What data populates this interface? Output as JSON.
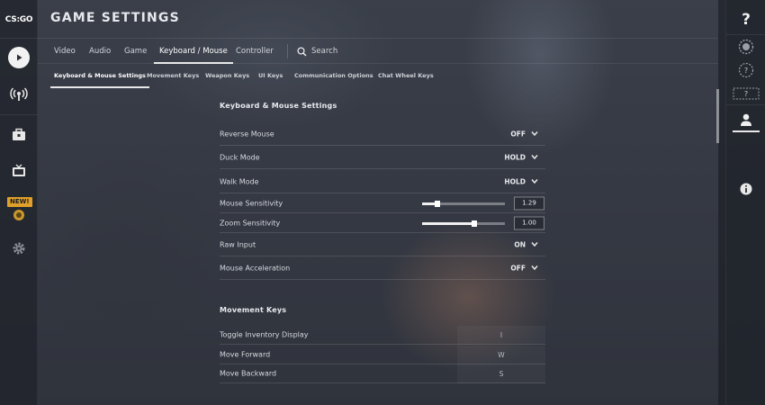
{
  "app": {
    "logo_text": "CS:GO",
    "title": "GAME SETTINGS"
  },
  "left_nav": {
    "new_badge": "NEW!",
    "items": [
      {
        "icon": "play-icon"
      },
      {
        "icon": "broadcast-icon"
      },
      {
        "icon": "inventory-icon"
      },
      {
        "icon": "tv-icon"
      },
      {
        "icon": "operation-icon"
      },
      {
        "icon": "settings-gear-icon"
      }
    ]
  },
  "tabs": [
    {
      "label": "Video"
    },
    {
      "label": "Audio"
    },
    {
      "label": "Game"
    },
    {
      "label": "Keyboard / Mouse",
      "active": true
    },
    {
      "label": "Controller"
    },
    {
      "label": "Search"
    }
  ],
  "subtabs": [
    {
      "label": "Keyboard & Mouse Settings",
      "active": true
    },
    {
      "label": "Movement Keys"
    },
    {
      "label": "Weapon Keys"
    },
    {
      "label": "UI Keys"
    },
    {
      "label": "Communication Options"
    },
    {
      "label": "Chat Wheel Keys"
    }
  ],
  "sections": {
    "km_title": "Keyboard & Mouse Settings",
    "reverse_mouse": {
      "label": "Reverse Mouse",
      "value": "OFF"
    },
    "duck_mode": {
      "label": "Duck Mode",
      "value": "HOLD"
    },
    "walk_mode": {
      "label": "Walk Mode",
      "value": "HOLD"
    },
    "mouse_sensitivity": {
      "label": "Mouse Sensitivity",
      "value": "1.29",
      "fill": 0.18
    },
    "zoom_sensitivity": {
      "label": "Zoom Sensitivity",
      "value": "1.00",
      "fill": 0.63
    },
    "raw_input": {
      "label": "Raw Input",
      "value": "ON"
    },
    "mouse_acceleration": {
      "label": "Mouse Acceleration",
      "value": "OFF"
    },
    "movement_title": "Movement Keys",
    "toggle_inventory": {
      "label": "Toggle Inventory Display",
      "key": "I"
    },
    "move_forward": {
      "label": "Move Forward",
      "key": "W"
    },
    "move_backward": {
      "label": "Move Backward",
      "key": "S"
    }
  },
  "right_nav": {
    "help_label": "?",
    "items": [
      {
        "icon": "help-icon"
      },
      {
        "icon": "rank-badge-icon"
      },
      {
        "icon": "unknown-rank-icon"
      },
      {
        "icon": "unknown-rank-box-icon"
      },
      {
        "icon": "profile-icon"
      },
      {
        "icon": "info-icon"
      }
    ]
  },
  "colors": {
    "accent": "#e8e8e8",
    "new_badge": "#e0a02a"
  }
}
